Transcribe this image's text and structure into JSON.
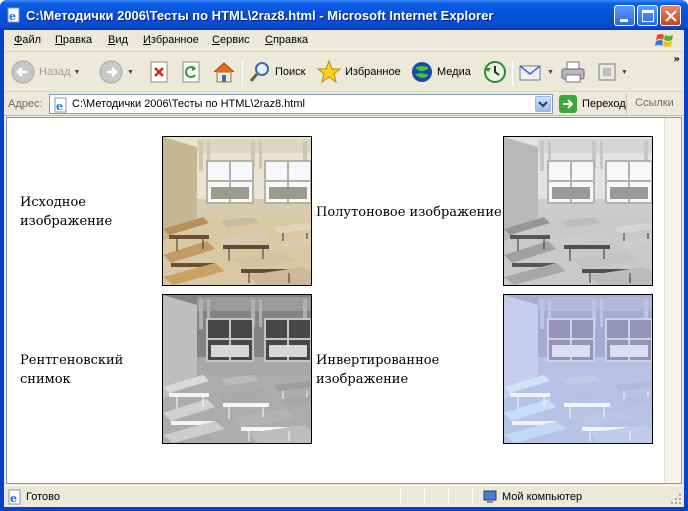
{
  "window": {
    "title": "C:\\Методички 2006\\Тесты по HTML\\2raz8.html - Microsoft Internet Explorer"
  },
  "menu": [
    "Файл",
    "Правка",
    "Вид",
    "Избранное",
    "Сервис",
    "Справка"
  ],
  "toolbar": {
    "back_label": "Назад",
    "search_label": "Поиск",
    "favorites_label": "Избранное",
    "media_label": "Медиа",
    "more": "»"
  },
  "address": {
    "label": "Адрес:",
    "url": "C:\\Методички 2006\\Тесты по HTML\\2raz8.html",
    "go_label": "Переход",
    "links_label": "Ссылки"
  },
  "content": {
    "captions": {
      "original": "Исходное изображение",
      "grayscale": "Полутоновое изображение",
      "xray": "Рентгеновский снимок",
      "inverted": "Инвертированное изображение"
    }
  },
  "status": {
    "text": "Готово",
    "zone": "Мой компьютер"
  },
  "colors": {
    "titlebar": "#0650d8",
    "chrome": "#ece9d8",
    "window_border": "#0842c6"
  }
}
